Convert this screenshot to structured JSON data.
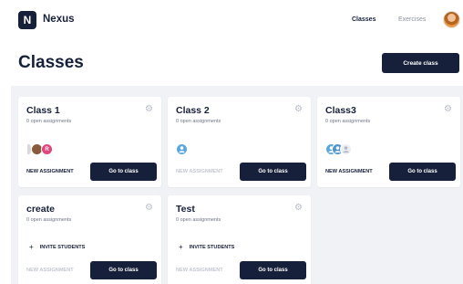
{
  "brand": {
    "logo_letter": "N",
    "name": "Nexus"
  },
  "nav": {
    "classes": "Classes",
    "exercises": "Exercises"
  },
  "header": {
    "title": "Classes",
    "create_label": "Create class"
  },
  "cards": [
    {
      "title": "Class 1",
      "subtitle": "0 open assignments",
      "new_label": "NEW ASSIGNMENT",
      "go_label": "Go to class",
      "avatar_initial": "R"
    },
    {
      "title": "Class 2",
      "subtitle": "0 open assignments",
      "new_label": "NEW ASSIGNMENT",
      "go_label": "Go to class"
    },
    {
      "title": "Class3",
      "subtitle": "0 open assignments",
      "new_label": "NEW ASSIGNMENT",
      "go_label": "Go to class"
    },
    {
      "title": "create",
      "subtitle": "0 open assignments",
      "invite_label": "INVITE STUDENTS",
      "new_label": "NEW ASSIGNMENT",
      "go_label": "Go to class"
    },
    {
      "title": "Test",
      "subtitle": "0 open assignments",
      "invite_label": "INVITE STUDENTS",
      "new_label": "NEW ASSIGNMENT",
      "go_label": "Go to class"
    }
  ],
  "colors": {
    "primary": "#17203a",
    "background": "#f1f2f5",
    "muted": "#c4c7d0",
    "avatar_pink": "#e0457b",
    "avatar_blue": "#5aa7e0"
  }
}
